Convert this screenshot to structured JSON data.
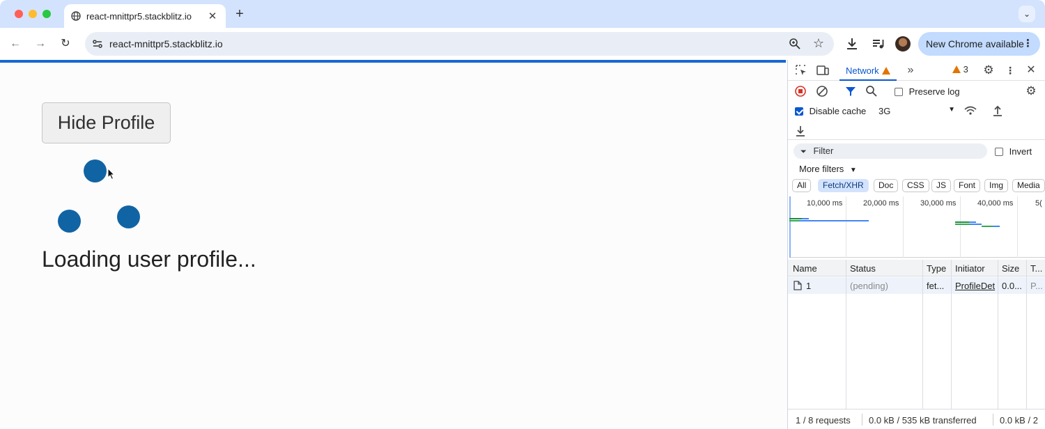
{
  "browser": {
    "tab_title": "react-mnittpr5.stackblitz.io",
    "url": "react-mnittpr5.stackblitz.io",
    "update_button_label": "New Chrome available"
  },
  "page": {
    "hide_button_label": "Hide Profile",
    "loading_text": "Loading user profile...",
    "accent_color": "#1164a3"
  },
  "devtools": {
    "active_tab": "Network",
    "issue_count": "3",
    "preserve_log_label": "Preserve log",
    "preserve_log_checked": false,
    "disable_cache_label": "Disable cache",
    "disable_cache_checked": true,
    "throttling": "3G",
    "filter_placeholder": "Filter",
    "invert_label": "Invert",
    "more_filters_label": "More filters",
    "type_filters": [
      "All",
      "Fetch/XHR",
      "Doc",
      "CSS",
      "JS",
      "Font",
      "Img",
      "Media"
    ],
    "active_type_filter": "Fetch/XHR",
    "timeline_labels": [
      "10,000 ms",
      "20,000 ms",
      "30,000 ms",
      "40,000 ms",
      "5("
    ],
    "columns": [
      "Name",
      "Status",
      "Type",
      "Initiator",
      "Size",
      "T..."
    ],
    "requests": [
      {
        "name": "1",
        "status": "(pending)",
        "type": "fet...",
        "initiator": "ProfileDet",
        "size": "0.0...",
        "time": "P..."
      }
    ],
    "status_bar": {
      "requests": "1 / 8 requests",
      "transferred": "0.0 kB / 535 kB transferred",
      "resources": "0.0 kB / 2"
    }
  }
}
